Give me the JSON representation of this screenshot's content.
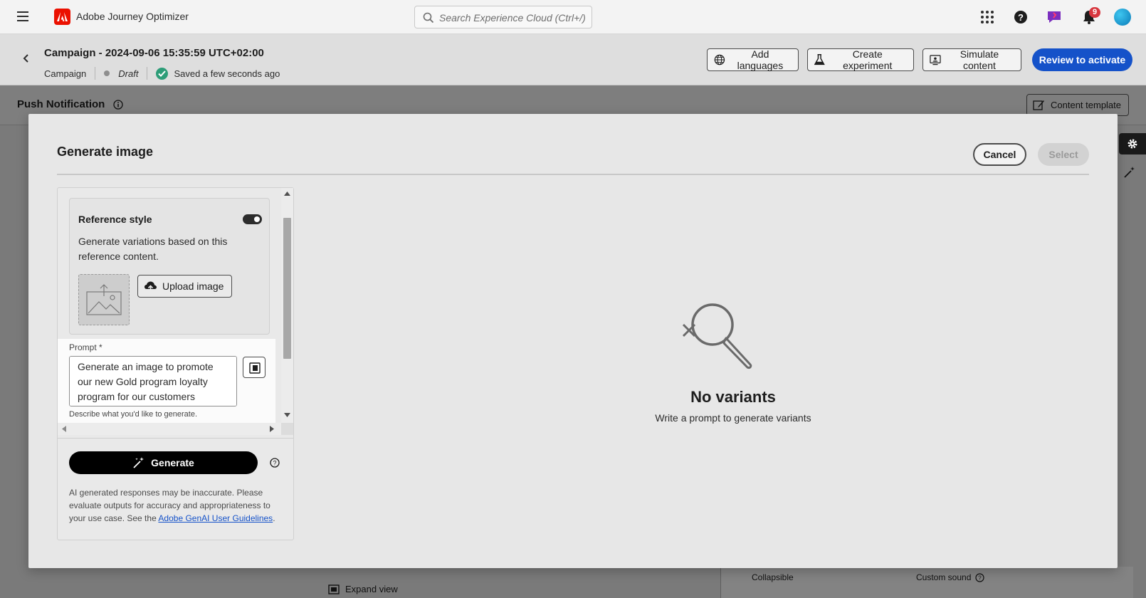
{
  "app": {
    "title": "Adobe Journey Optimizer",
    "search_placeholder": "Search Experience Cloud (Ctrl+/)",
    "notification_count": "9",
    "brand_color": "#eb1000",
    "accent_color": "#1552c9"
  },
  "campaign": {
    "title": "Campaign - 2024-09-06 15:35:59 UTC+02:00",
    "type": "Campaign",
    "status": "Draft",
    "saved": "Saved a few seconds ago",
    "buttons": {
      "add_languages": "Add languages",
      "create_experiment": "Create experiment",
      "simulate_content": "Simulate content",
      "review_to_activate": "Review to activate"
    }
  },
  "background": {
    "section_title": "Push Notification",
    "content_template": "Content template",
    "collapsible": "Collapsible",
    "custom_sound": "Custom sound",
    "expand_view": "Expand view"
  },
  "modal": {
    "title": "Generate image",
    "cancel": "Cancel",
    "select": "Select",
    "reference": {
      "title": "Reference style",
      "enabled": true,
      "description": "Generate variations based on this reference content.",
      "upload": "Upload image"
    },
    "prompt": {
      "label": "Prompt",
      "required_marker": "*",
      "value": "Generate an image to promote our new Gold program loyalty program for our customers",
      "help": "Describe what you'd like to generate."
    },
    "generate": "Generate",
    "disclaimer_text": "AI generated responses may be inaccurate. Please evaluate outputs for accuracy and appropriateness to your use case. See the ",
    "disclaimer_link": "Adobe GenAI User Guidelines",
    "disclaimer_end": ".",
    "empty": {
      "title": "No variants",
      "description": "Write a prompt to generate variants"
    }
  }
}
